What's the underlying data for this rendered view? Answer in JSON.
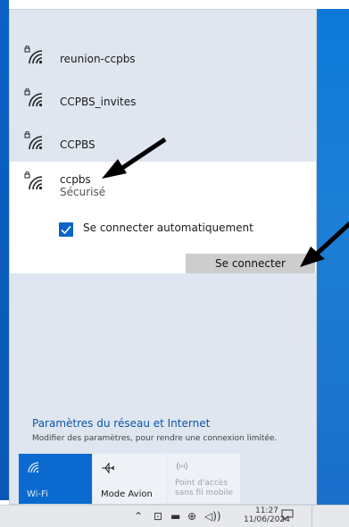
{
  "networks": [
    {
      "name": "reunion-ccpbs",
      "secured": true
    },
    {
      "name": "CCPBS_invites",
      "secured": true
    },
    {
      "name": "CCPBS",
      "secured": true
    }
  ],
  "selected_network": {
    "name": "ccpbs",
    "status": "Sécurisé",
    "auto_connect_label": "Se connecter automatiquement",
    "auto_connect_checked": true,
    "connect_button": "Se connecter"
  },
  "settings": {
    "title": "Paramètres du réseau et Internet",
    "subtitle": "Modifier des paramètres, pour rendre une connexion limitée."
  },
  "quick_actions": [
    {
      "label": "Wi-Fi",
      "icon": "wifi-icon",
      "active": true
    },
    {
      "label": "Mode Avion",
      "icon": "airplane-icon",
      "active": false
    },
    {
      "label_line1": "Point d'accès",
      "label_line2": "sans fil mobile",
      "icon": "hotspot-icon",
      "active": false,
      "disabled": true
    }
  ],
  "taskbar": {
    "time": "11:27",
    "date": "11/06/2024"
  },
  "colors": {
    "accent": "#0a6ad0",
    "panel_bg": "#dfe6ef",
    "link": "#0a55a6"
  }
}
